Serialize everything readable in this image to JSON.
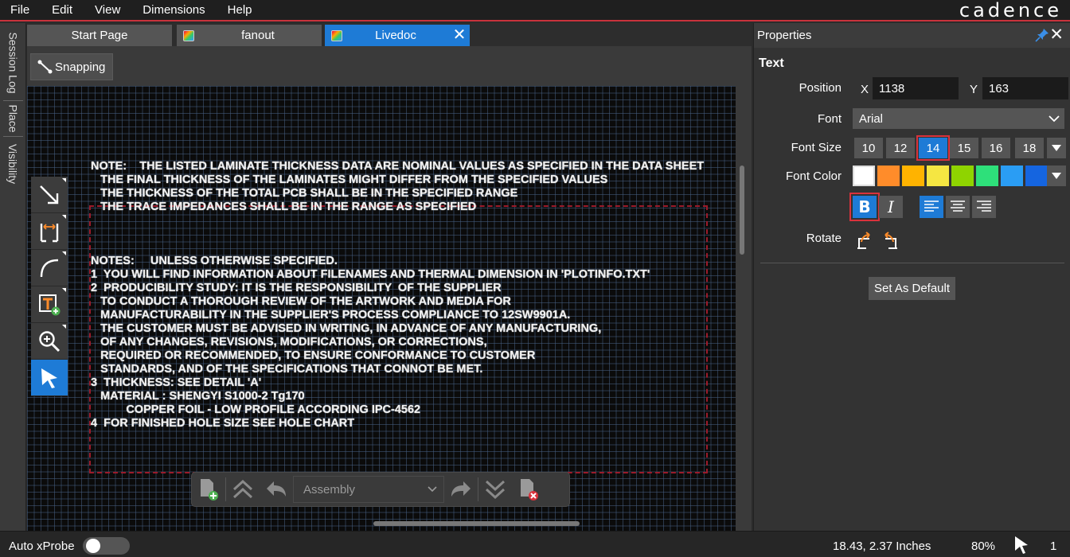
{
  "menu": [
    "File",
    "Edit",
    "View",
    "Dimensions",
    "Help"
  ],
  "brand": "cadence",
  "left_tabs": [
    "Session Log",
    "Place",
    "Visibility"
  ],
  "doc_tabs": [
    {
      "label": "Start Page"
    },
    {
      "label": "fanout"
    },
    {
      "label": "Livedoc"
    }
  ],
  "snapping_label": "Snapping",
  "note_lines": [
    "NOTE:    THE LISTED LAMINATE THICKNESS DATA ARE NOMINAL VALUES AS SPECIFIED IN THE DATA SHEET",
    "   THE FINAL THICKNESS OF THE LAMINATES MIGHT DIFFER FROM THE SPECIFIED VALUES",
    "   THE THICKNESS OF THE TOTAL PCB SHALL BE IN THE SPECIFIED RANGE",
    "   THE TRACE IMPEDANCES SHALL BE IN THE RANGE AS SPECIFIED",
    "",
    "",
    "",
    "NOTES:     UNLESS OTHERWISE SPECIFIED.",
    "1  YOU WILL FIND INFORMATION ABOUT FILENAMES AND THERMAL DIMENSION IN 'PLOTINFO.TXT'",
    "2  PRODUCIBILITY STUDY: IT IS THE RESPONSIBILITY  OF THE SUPPLIER",
    "   TO CONDUCT A THOROUGH REVIEW OF THE ARTWORK AND MEDIA FOR",
    "   MANUFACTURABILITY IN THE SUPPLIER'S PROCESS COMPLIANCE TO 12SW9901A.",
    "   THE CUSTOMER MUST BE ADVISED IN WRITING, IN ADVANCE OF ANY MANUFACTURING,",
    "   OF ANY CHANGES, REVISIONS, MODIFICATIONS, OR CORRECTIONS,",
    "   REQUIRED OR RECOMMENDED, TO ENSURE CONFORMANCE TO CUSTOMER",
    "   STANDARDS, AND OF THE SPECIFICATIONS THAT CONNOT BE MET.",
    "3  THICKNESS: SEE DETAIL 'A'",
    "   MATERIAL : SHENGYI S1000-2 Tg170",
    "           COPPER FOIL - LOW PROFILE ACCORDING IPC-4562",
    "4  FOR FINISHED HOLE SIZE SEE HOLE CHART"
  ],
  "tools": [
    "arrow-line-icon",
    "dimension-icon",
    "arc-icon",
    "add-text-icon",
    "zoom-in-icon",
    "select-pointer-icon"
  ],
  "floatbar": {
    "layer_select": "Assembly"
  },
  "properties": {
    "title": "Properties",
    "section": "Text",
    "position_label": "Position",
    "x_label": "X",
    "x_value": "1138",
    "y_label": "Y",
    "y_value": "163",
    "font_label": "Font",
    "font_value": "Arial",
    "font_size_label": "Font Size",
    "font_sizes": [
      "10",
      "12",
      "14",
      "15",
      "16",
      "18"
    ],
    "selected_size": "14",
    "font_color_label": "Font Color",
    "colors": [
      "#ffffff",
      "#ff8c2a",
      "#ffb300",
      "#f5e642",
      "#8fd400",
      "#2ee07a",
      "#2a9df4",
      "#1565e0"
    ],
    "bold_label": "B",
    "italic_label": "I",
    "rotate_label": "Rotate",
    "set_default_label": "Set As Default"
  },
  "status": {
    "auto_xprobe_label": "Auto xProbe",
    "auto_xprobe_on": false,
    "coords": "18.43, 2.37 Inches",
    "zoom": "80%",
    "selected_count": "1"
  },
  "accent_colors": {
    "active_blue": "#1e7bd6",
    "highlight_red": "#d9323c"
  }
}
